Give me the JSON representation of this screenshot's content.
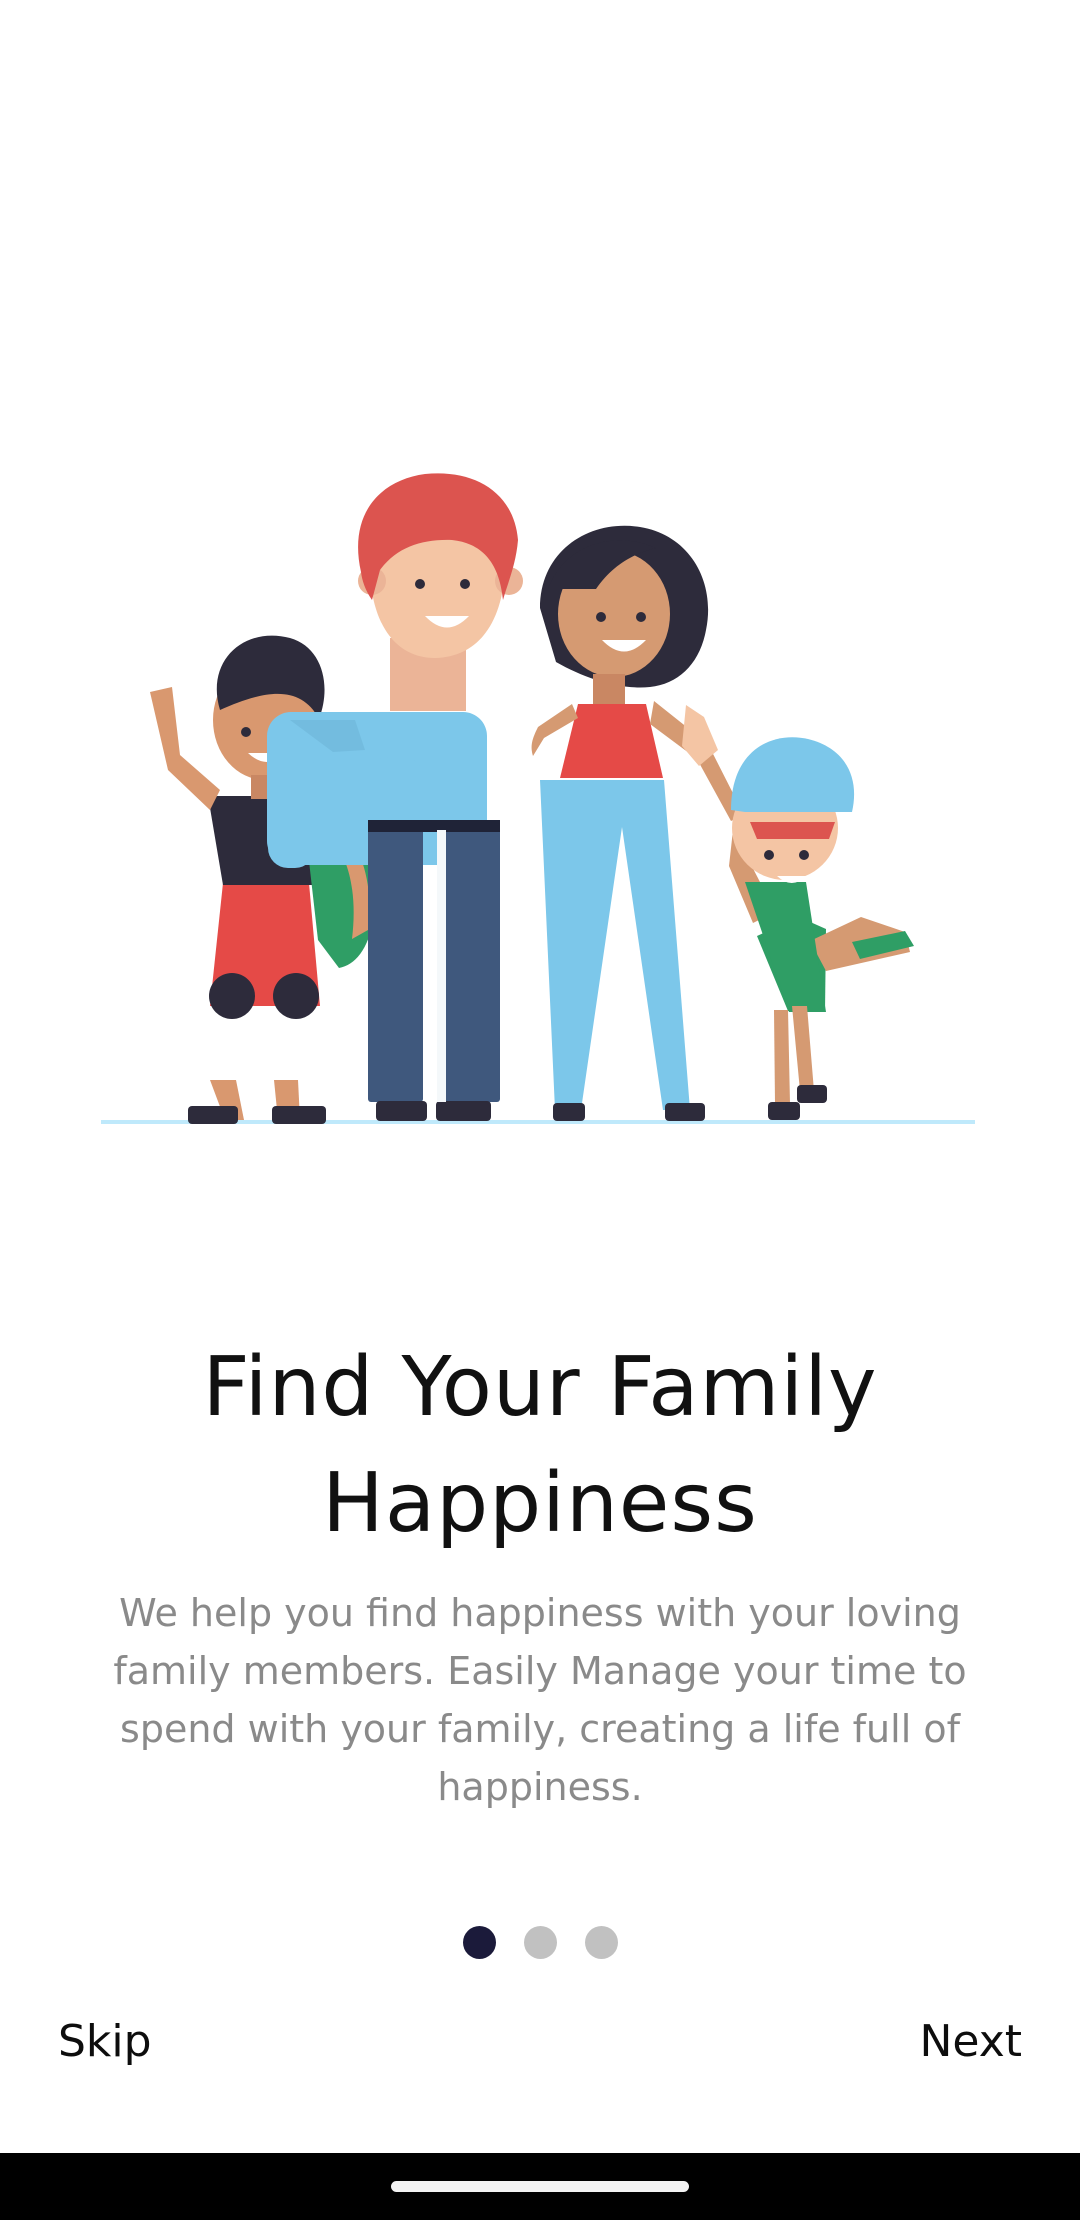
{
  "onboarding": {
    "illustration_name": "family-illustration",
    "title_line1": "Find Your Family",
    "title_line2": "Happiness",
    "description": "We help you find happiness with your loving family members. Easily Manage your time to spend with your family, creating a life full of happiness.",
    "pager": {
      "current_page": 1,
      "total_pages": 3
    },
    "skip_label": "Skip",
    "next_label": "Next"
  },
  "colors": {
    "background": "#ffffff",
    "title": "#111111",
    "description": "#8a8a8a",
    "active_dot": "#1b1a3a",
    "inactive_dot": "#c1c1c1",
    "system_bar": "#000000"
  }
}
